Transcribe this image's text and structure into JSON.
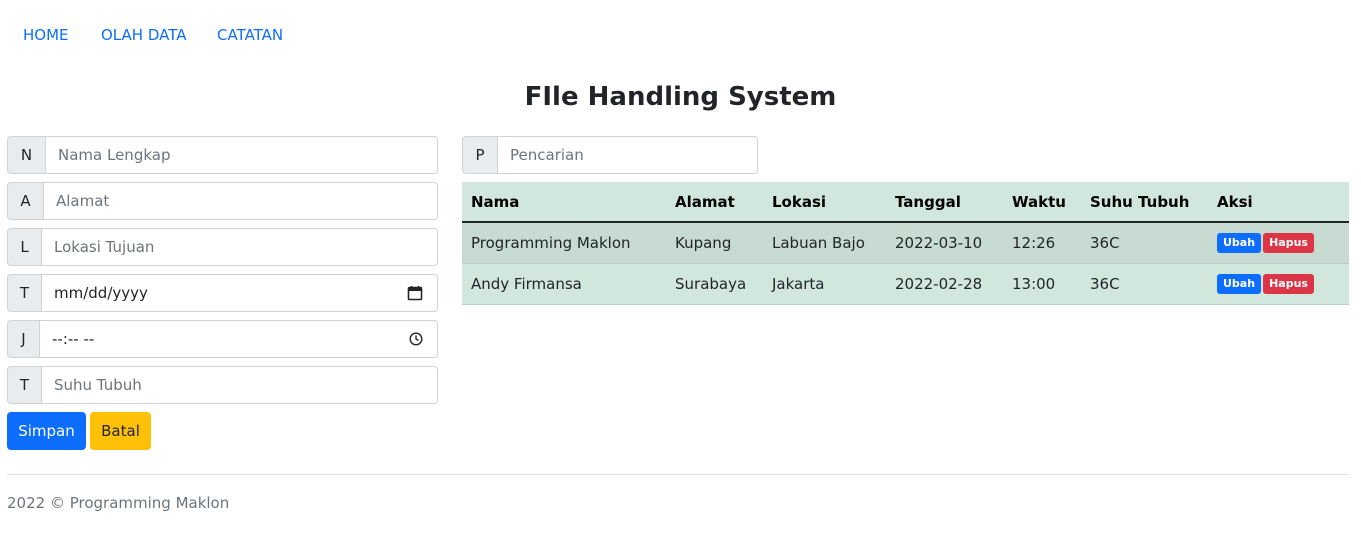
{
  "nav": {
    "items": [
      "HOME",
      "OLAH DATA",
      "CATATAN"
    ]
  },
  "page_title": "FIle Handling System",
  "form": {
    "name": {
      "prefix": "N",
      "placeholder": "Nama Lengkap"
    },
    "address": {
      "prefix": "A",
      "placeholder": "Alamat"
    },
    "location": {
      "prefix": "L",
      "placeholder": "Lokasi Tujuan"
    },
    "date": {
      "prefix": "T",
      "placeholder": "mm/dd/yyyy"
    },
    "time": {
      "prefix": "J",
      "placeholder": "--:-- --"
    },
    "temperature": {
      "prefix": "T",
      "placeholder": "Suhu Tubuh"
    },
    "save_label": "Simpan",
    "cancel_label": "Batal"
  },
  "search": {
    "prefix": "P",
    "placeholder": "Pencarian"
  },
  "table": {
    "headers": [
      "Nama",
      "Alamat",
      "Lokasi",
      "Tanggal",
      "Waktu",
      "Suhu Tubuh",
      "Aksi"
    ],
    "rows": [
      {
        "nama": "Programming Maklon",
        "alamat": "Kupang",
        "lokasi": "Labuan Bajo",
        "tanggal": "2022-03-10",
        "waktu": "12:26",
        "suhu": "36C"
      },
      {
        "nama": "Andy Firmansa",
        "alamat": "Surabaya",
        "lokasi": "Jakarta",
        "tanggal": "2022-02-28",
        "waktu": "13:00",
        "suhu": "36C"
      }
    ],
    "edit_label": "Ubah",
    "delete_label": "Hapus"
  },
  "footer": {
    "text": "2022 © Programming Maklon"
  },
  "colors": {
    "primary": "#0d6efd",
    "warning": "#ffc107",
    "danger": "#dc3545",
    "table_bg": "#d1e7dd"
  }
}
